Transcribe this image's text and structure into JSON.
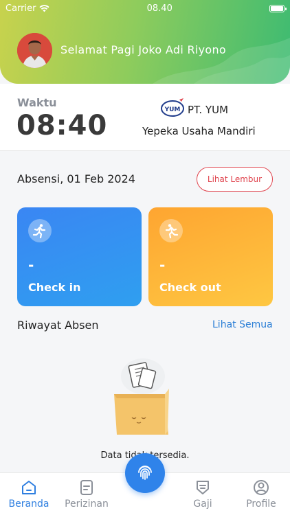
{
  "status_bar": {
    "carrier": "Carrier",
    "time": "08.40"
  },
  "header": {
    "greeting": "Selamat Pagi Joko Adi Riyono"
  },
  "info": {
    "time_label": "Waktu",
    "time_value": "08:40",
    "logo_text": "YUM",
    "company_short": "PT. YUM",
    "company_name": "Yepeka Usaha Mandiri"
  },
  "attendance": {
    "date_label": "Absensi, 01 Feb 2024",
    "overtime_button": "Lihat Lembur",
    "check_in": {
      "time": "-",
      "label": "Check in"
    },
    "check_out": {
      "time": "-",
      "label": "Check out"
    }
  },
  "history": {
    "title": "Riwayat Absen",
    "see_all": "Lihat Semua",
    "empty_text": "Data tidak tersedia."
  },
  "nav": {
    "items": [
      {
        "label": "Beranda",
        "icon": "home-icon",
        "active": true
      },
      {
        "label": "Perizinan",
        "icon": "document-icon",
        "active": false
      },
      {
        "label": "Gaji",
        "icon": "shield-icon",
        "active": false
      },
      {
        "label": "Profile",
        "icon": "user-icon",
        "active": false
      }
    ],
    "fab_icon": "fingerprint-icon"
  },
  "colors": {
    "accent": "#2f83ea",
    "check_in": "#3a86f3",
    "check_out": "#fea531",
    "danger": "#e0454f"
  }
}
